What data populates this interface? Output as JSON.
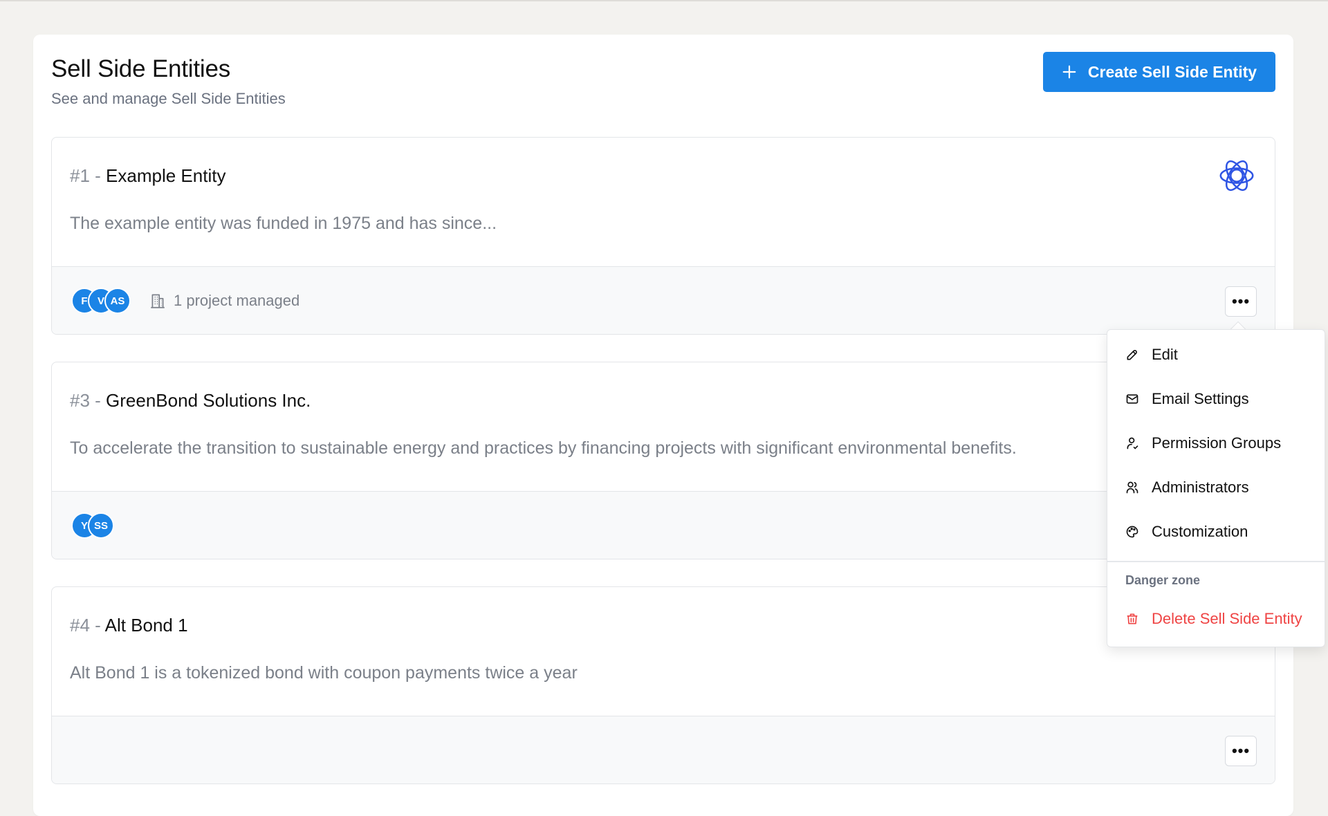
{
  "header": {
    "title": "Sell Side Entities",
    "subtitle": "See and manage Sell Side Entities",
    "create_label": "Create Sell Side Entity"
  },
  "entities": [
    {
      "number": "#1 -",
      "name": "Example Entity",
      "description": "The example entity was funded in 1975 and has since...",
      "avatars": [
        "F",
        "V",
        "AS"
      ],
      "projects_label": "1 project managed",
      "more_label": "•••"
    },
    {
      "number": "#3 -",
      "name": "GreenBond Solutions Inc.",
      "description": "To accelerate the transition to sustainable energy and practices by financing projects with significant environmental benefits.",
      "avatars": [
        "Y",
        "SS"
      ]
    },
    {
      "number": "#4 -",
      "name": "Alt Bond 1",
      "description": "Alt Bond 1 is a tokenized bond with coupon payments twice a year",
      "avatars": [],
      "more_label": "•••"
    }
  ],
  "menu": {
    "items": [
      {
        "label": "Edit",
        "icon": "edit-icon"
      },
      {
        "label": "Email Settings",
        "icon": "mail-icon"
      },
      {
        "label": "Permission Groups",
        "icon": "user-key-icon"
      },
      {
        "label": "Administrators",
        "icon": "users-icon"
      },
      {
        "label": "Customization",
        "icon": "palette-icon"
      }
    ],
    "danger_heading": "Danger zone",
    "delete_label": "Delete Sell Side Entity"
  },
  "colors": {
    "primary": "#1b84e6",
    "danger": "#ef4444",
    "logo": "#2f55e4"
  }
}
